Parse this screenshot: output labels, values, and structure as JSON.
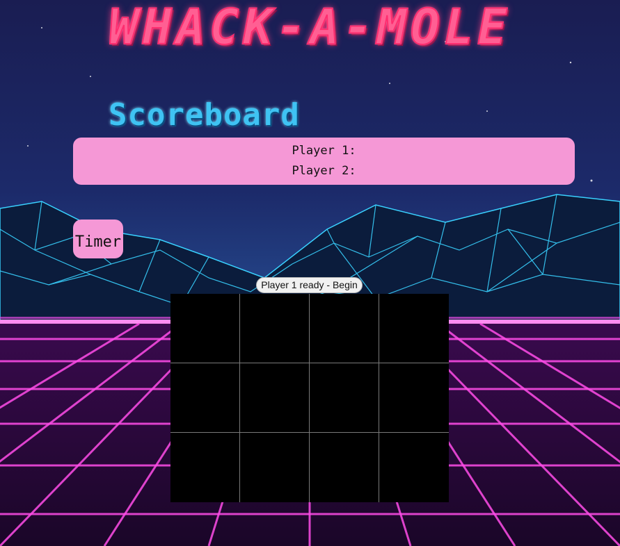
{
  "title": "WHACK-A-MOLE",
  "scoreboard": {
    "heading": "Scoreboard",
    "player1_label": "Player 1:",
    "player2_label": "Player 2:"
  },
  "timer": {
    "label": "Timer"
  },
  "begin_button": {
    "label": "Player 1 ready - Begin"
  },
  "board": {
    "rows": 3,
    "cols": 4
  },
  "colors": {
    "panel": "#f598d6",
    "title": "#ff5f93",
    "heading": "#3fc3f3",
    "board": "#000000",
    "grid_line": "#7a7a7a"
  }
}
